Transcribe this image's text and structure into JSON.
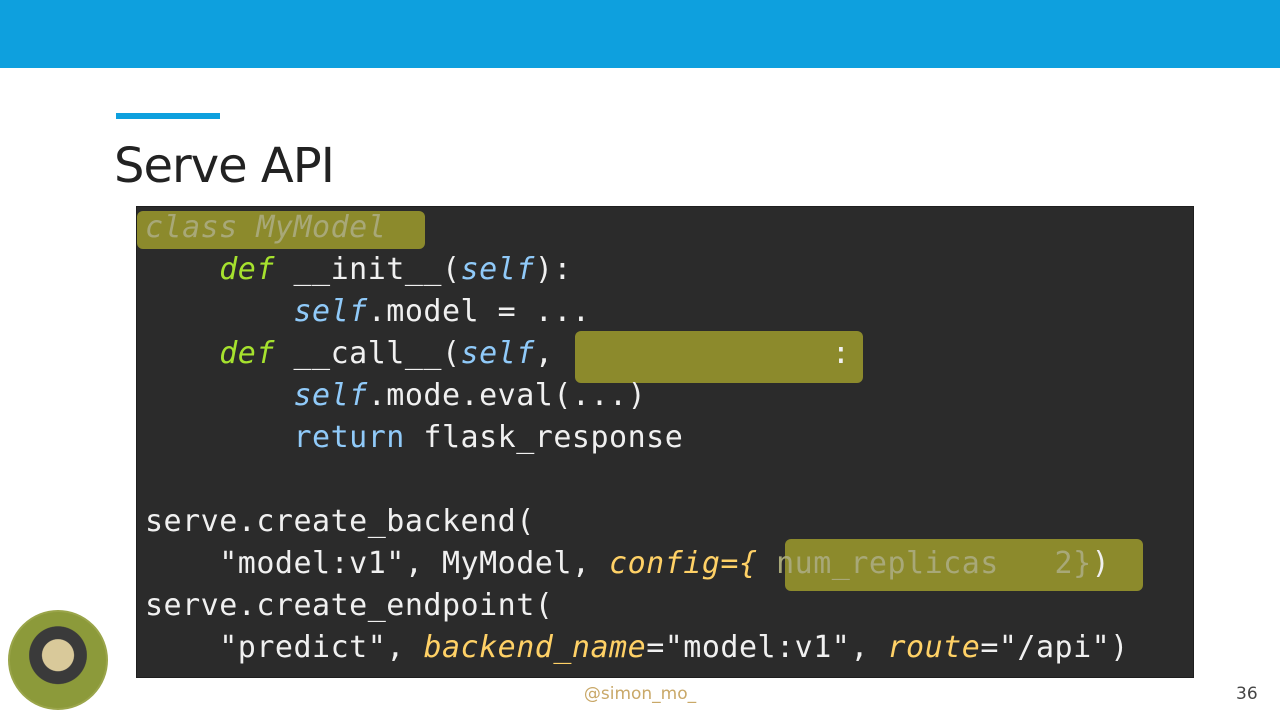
{
  "slide": {
    "title": "Serve API",
    "handle": "@simon_mo_",
    "page_number": "36",
    "colors": {
      "accent": "#0ea0de",
      "code_bg": "#2b2b2b",
      "highlight": "#8c8a2c"
    }
  },
  "code": {
    "line1": {
      "text": "class MyModel"
    },
    "line2": {
      "def": "def",
      "name": " __init__(",
      "self": "self",
      "end": "):"
    },
    "line3": {
      "self": "self",
      "rest": ".model = ..."
    },
    "line4": {
      "def": "def",
      "name": " __call__(",
      "self": "self",
      "comma": ",",
      "end": ":"
    },
    "line5": {
      "self": "self",
      "rest": ".mode.eval(...)"
    },
    "line6": {
      "ret": "return",
      "rest": " flask_response"
    },
    "line8": {
      "text": "serve.create_backend("
    },
    "line9": {
      "s1": "\"model:v1\", MyModel, ",
      "kw": "config",
      "eq": "={",
      "hl": " num_replicas   2",
      "end": "}",
      "close": ")"
    },
    "line10": {
      "text": "serve.create_endpoint("
    },
    "line11": {
      "s1": "\"predict\", ",
      "kw1": "backend_name",
      "v1": "=\"model:v1\", ",
      "kw2": "route",
      "v2": "=\"/api\")"
    }
  }
}
